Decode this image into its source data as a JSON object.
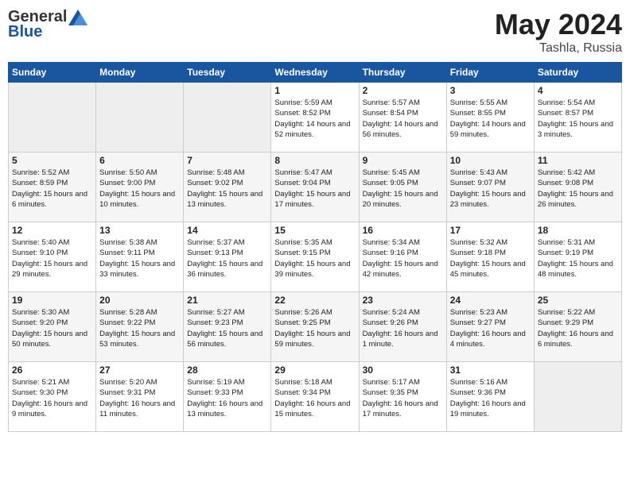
{
  "header": {
    "logo_general": "General",
    "logo_blue": "Blue",
    "title": "May 2024",
    "location": "Tashla, Russia"
  },
  "days_of_week": [
    "Sunday",
    "Monday",
    "Tuesday",
    "Wednesday",
    "Thursday",
    "Friday",
    "Saturday"
  ],
  "weeks": [
    [
      {
        "day": "",
        "empty": true
      },
      {
        "day": "",
        "empty": true
      },
      {
        "day": "",
        "empty": true
      },
      {
        "day": "1",
        "sunrise": "Sunrise: 5:59 AM",
        "sunset": "Sunset: 8:52 PM",
        "daylight": "Daylight: 14 hours and 52 minutes."
      },
      {
        "day": "2",
        "sunrise": "Sunrise: 5:57 AM",
        "sunset": "Sunset: 8:54 PM",
        "daylight": "Daylight: 14 hours and 56 minutes."
      },
      {
        "day": "3",
        "sunrise": "Sunrise: 5:55 AM",
        "sunset": "Sunset: 8:55 PM",
        "daylight": "Daylight: 14 hours and 59 minutes."
      },
      {
        "day": "4",
        "sunrise": "Sunrise: 5:54 AM",
        "sunset": "Sunset: 8:57 PM",
        "daylight": "Daylight: 15 hours and 3 minutes."
      }
    ],
    [
      {
        "day": "5",
        "sunrise": "Sunrise: 5:52 AM",
        "sunset": "Sunset: 8:59 PM",
        "daylight": "Daylight: 15 hours and 6 minutes."
      },
      {
        "day": "6",
        "sunrise": "Sunrise: 5:50 AM",
        "sunset": "Sunset: 9:00 PM",
        "daylight": "Daylight: 15 hours and 10 minutes."
      },
      {
        "day": "7",
        "sunrise": "Sunrise: 5:48 AM",
        "sunset": "Sunset: 9:02 PM",
        "daylight": "Daylight: 15 hours and 13 minutes."
      },
      {
        "day": "8",
        "sunrise": "Sunrise: 5:47 AM",
        "sunset": "Sunset: 9:04 PM",
        "daylight": "Daylight: 15 hours and 17 minutes."
      },
      {
        "day": "9",
        "sunrise": "Sunrise: 5:45 AM",
        "sunset": "Sunset: 9:05 PM",
        "daylight": "Daylight: 15 hours and 20 minutes."
      },
      {
        "day": "10",
        "sunrise": "Sunrise: 5:43 AM",
        "sunset": "Sunset: 9:07 PM",
        "daylight": "Daylight: 15 hours and 23 minutes."
      },
      {
        "day": "11",
        "sunrise": "Sunrise: 5:42 AM",
        "sunset": "Sunset: 9:08 PM",
        "daylight": "Daylight: 15 hours and 26 minutes."
      }
    ],
    [
      {
        "day": "12",
        "sunrise": "Sunrise: 5:40 AM",
        "sunset": "Sunset: 9:10 PM",
        "daylight": "Daylight: 15 hours and 29 minutes."
      },
      {
        "day": "13",
        "sunrise": "Sunrise: 5:38 AM",
        "sunset": "Sunset: 9:11 PM",
        "daylight": "Daylight: 15 hours and 33 minutes."
      },
      {
        "day": "14",
        "sunrise": "Sunrise: 5:37 AM",
        "sunset": "Sunset: 9:13 PM",
        "daylight": "Daylight: 15 hours and 36 minutes."
      },
      {
        "day": "15",
        "sunrise": "Sunrise: 5:35 AM",
        "sunset": "Sunset: 9:15 PM",
        "daylight": "Daylight: 15 hours and 39 minutes."
      },
      {
        "day": "16",
        "sunrise": "Sunrise: 5:34 AM",
        "sunset": "Sunset: 9:16 PM",
        "daylight": "Daylight: 15 hours and 42 minutes."
      },
      {
        "day": "17",
        "sunrise": "Sunrise: 5:32 AM",
        "sunset": "Sunset: 9:18 PM",
        "daylight": "Daylight: 15 hours and 45 minutes."
      },
      {
        "day": "18",
        "sunrise": "Sunrise: 5:31 AM",
        "sunset": "Sunset: 9:19 PM",
        "daylight": "Daylight: 15 hours and 48 minutes."
      }
    ],
    [
      {
        "day": "19",
        "sunrise": "Sunrise: 5:30 AM",
        "sunset": "Sunset: 9:20 PM",
        "daylight": "Daylight: 15 hours and 50 minutes."
      },
      {
        "day": "20",
        "sunrise": "Sunrise: 5:28 AM",
        "sunset": "Sunset: 9:22 PM",
        "daylight": "Daylight: 15 hours and 53 minutes."
      },
      {
        "day": "21",
        "sunrise": "Sunrise: 5:27 AM",
        "sunset": "Sunset: 9:23 PM",
        "daylight": "Daylight: 15 hours and 56 minutes."
      },
      {
        "day": "22",
        "sunrise": "Sunrise: 5:26 AM",
        "sunset": "Sunset: 9:25 PM",
        "daylight": "Daylight: 15 hours and 59 minutes."
      },
      {
        "day": "23",
        "sunrise": "Sunrise: 5:24 AM",
        "sunset": "Sunset: 9:26 PM",
        "daylight": "Daylight: 16 hours and 1 minute."
      },
      {
        "day": "24",
        "sunrise": "Sunrise: 5:23 AM",
        "sunset": "Sunset: 9:27 PM",
        "daylight": "Daylight: 16 hours and 4 minutes."
      },
      {
        "day": "25",
        "sunrise": "Sunrise: 5:22 AM",
        "sunset": "Sunset: 9:29 PM",
        "daylight": "Daylight: 16 hours and 6 minutes."
      }
    ],
    [
      {
        "day": "26",
        "sunrise": "Sunrise: 5:21 AM",
        "sunset": "Sunset: 9:30 PM",
        "daylight": "Daylight: 16 hours and 9 minutes."
      },
      {
        "day": "27",
        "sunrise": "Sunrise: 5:20 AM",
        "sunset": "Sunset: 9:31 PM",
        "daylight": "Daylight: 16 hours and 11 minutes."
      },
      {
        "day": "28",
        "sunrise": "Sunrise: 5:19 AM",
        "sunset": "Sunset: 9:33 PM",
        "daylight": "Daylight: 16 hours and 13 minutes."
      },
      {
        "day": "29",
        "sunrise": "Sunrise: 5:18 AM",
        "sunset": "Sunset: 9:34 PM",
        "daylight": "Daylight: 16 hours and 15 minutes."
      },
      {
        "day": "30",
        "sunrise": "Sunrise: 5:17 AM",
        "sunset": "Sunset: 9:35 PM",
        "daylight": "Daylight: 16 hours and 17 minutes."
      },
      {
        "day": "31",
        "sunrise": "Sunrise: 5:16 AM",
        "sunset": "Sunset: 9:36 PM",
        "daylight": "Daylight: 16 hours and 19 minutes."
      },
      {
        "day": "",
        "empty": true
      }
    ]
  ]
}
